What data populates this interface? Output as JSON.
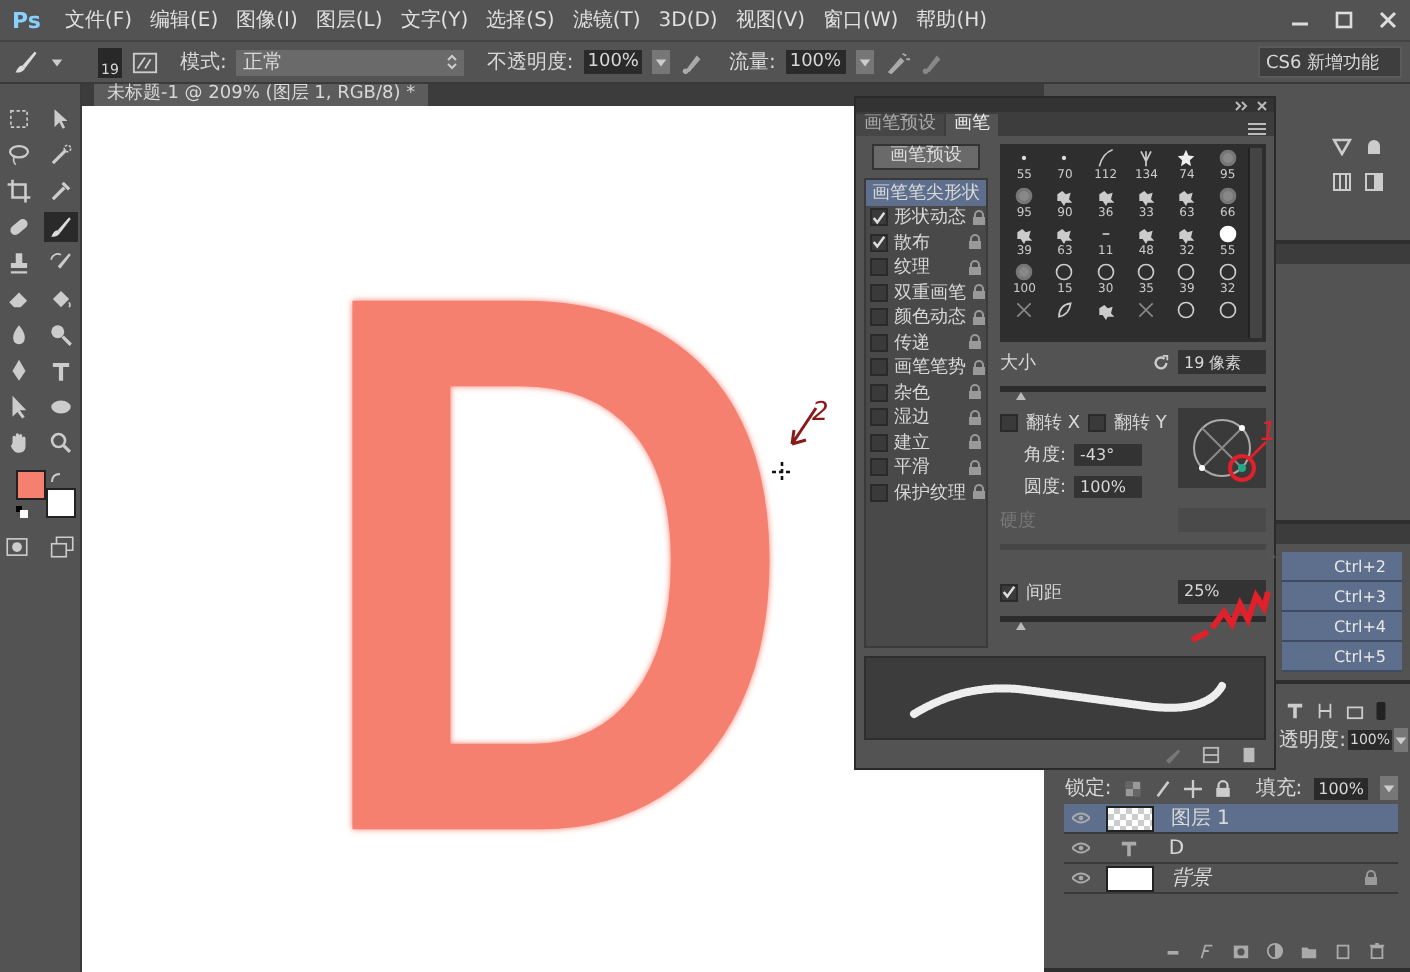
{
  "app": {
    "logo": "Ps"
  },
  "menu": [
    "文件(F)",
    "编辑(E)",
    "图像(I)",
    "图层(L)",
    "文字(Y)",
    "选择(S)",
    "滤镜(T)",
    "3D(D)",
    "视图(V)",
    "窗口(W)",
    "帮助(H)"
  ],
  "options": {
    "size": "19",
    "mode_label": "模式:",
    "mode": "正常",
    "opacity_label": "不透明度:",
    "opacity": "100%",
    "flow_label": "流量:",
    "flow": "100%",
    "workspace": "CS6 新增功能"
  },
  "document": {
    "tab": "未标题-1 @ 209% (图层 1, RGB/8) *",
    "letter": "D"
  },
  "tools": [
    {
      "kind": "marquee",
      "selected": false
    },
    {
      "kind": "move",
      "selected": false
    },
    {
      "kind": "lasso",
      "selected": false
    },
    {
      "kind": "quickselect",
      "selected": false
    },
    {
      "kind": "crop",
      "selected": false
    },
    {
      "kind": "eyedropper",
      "selected": false
    },
    {
      "kind": "healing",
      "selected": false
    },
    {
      "kind": "brush",
      "selected": true
    },
    {
      "kind": "stamp",
      "selected": false
    },
    {
      "kind": "historybrush",
      "selected": false
    },
    {
      "kind": "eraser",
      "selected": false
    },
    {
      "kind": "bucket",
      "selected": false
    },
    {
      "kind": "blur",
      "selected": false
    },
    {
      "kind": "dodge",
      "selected": false
    },
    {
      "kind": "pen",
      "selected": false
    },
    {
      "kind": "text",
      "selected": false
    },
    {
      "kind": "pathselect",
      "selected": false
    },
    {
      "kind": "ellipse",
      "selected": false
    },
    {
      "kind": "hand",
      "selected": false
    },
    {
      "kind": "zoom",
      "selected": false
    }
  ],
  "tools_bottom": [
    {
      "kind": "quickmask"
    },
    {
      "kind": "screenmode"
    }
  ],
  "brush_panel": {
    "tabs": [
      {
        "label": "画笔预设",
        "selected": false
      },
      {
        "label": "画笔",
        "selected": true
      }
    ],
    "preset_button": "画笔预设",
    "sections": [
      {
        "kind": "header",
        "label": "画笔笔尖形状",
        "selected": true
      },
      {
        "kind": "option",
        "label": "形状动态",
        "checked": true
      },
      {
        "kind": "option",
        "label": "散布",
        "checked": true
      },
      {
        "kind": "option",
        "label": "纹理",
        "checked": false
      },
      {
        "kind": "option",
        "label": "双重画笔",
        "checked": false
      },
      {
        "kind": "option",
        "label": "颜色动态",
        "checked": false
      },
      {
        "kind": "option",
        "label": "传递",
        "checked": false
      },
      {
        "kind": "option",
        "label": "画笔笔势",
        "checked": false
      },
      {
        "kind": "option",
        "label": "杂色",
        "checked": false
      },
      {
        "kind": "option",
        "label": "湿边",
        "checked": false
      },
      {
        "kind": "option",
        "label": "建立",
        "checked": false
      },
      {
        "kind": "option",
        "label": "平滑",
        "checked": false
      },
      {
        "kind": "option",
        "label": "保护纹理",
        "checked": false
      }
    ],
    "tips": [
      {
        "kind": "dot",
        "size": "55"
      },
      {
        "kind": "dot",
        "size": "70"
      },
      {
        "kind": "stroke",
        "size": "112"
      },
      {
        "kind": "grass",
        "size": "134"
      },
      {
        "kind": "star",
        "size": "74"
      },
      {
        "kind": "soft",
        "size": "95"
      },
      {
        "kind": "soft",
        "size": "95"
      },
      {
        "kind": "splat",
        "size": "90"
      },
      {
        "kind": "splat",
        "size": "36"
      },
      {
        "kind": "splat",
        "size": "33"
      },
      {
        "kind": "splat",
        "size": "63"
      },
      {
        "kind": "soft",
        "size": "66"
      },
      {
        "kind": "splat",
        "size": "39"
      },
      {
        "kind": "splat",
        "size": "63"
      },
      {
        "kind": "dash",
        "size": "11"
      },
      {
        "kind": "splat",
        "size": "48"
      },
      {
        "kind": "splat",
        "size": "32"
      },
      {
        "kind": "hard",
        "size": "55"
      },
      {
        "kind": "soft",
        "size": "100"
      },
      {
        "kind": "ring",
        "size": "15"
      },
      {
        "kind": "ring",
        "size": "30"
      },
      {
        "kind": "ring",
        "size": "35"
      },
      {
        "kind": "ring",
        "size": "39"
      },
      {
        "kind": "ring",
        "size": "32"
      },
      {
        "kind": "cross"
      },
      {
        "kind": "leaf"
      },
      {
        "kind": "splat"
      },
      {
        "kind": "cross"
      },
      {
        "kind": "ring"
      },
      {
        "kind": "ring"
      }
    ],
    "size_label": "大小",
    "size": "19 像素",
    "size_slider": {
      "level": 0.06
    },
    "flips": [
      {
        "label": "翻转 X",
        "checked": false
      },
      {
        "label": "翻转 Y",
        "checked": false
      }
    ],
    "angle_label": "角度:",
    "angle": "-43°",
    "roundness_label": "圆度:",
    "roundness": "100%",
    "hardness": {
      "label": "硬度",
      "disabled": true,
      "level": 1
    },
    "spacing": {
      "label": "间距",
      "checked": true,
      "value": "25%",
      "level": 0.06
    }
  },
  "channels": [
    {
      "shortcut": "Ctrl+2"
    },
    {
      "shortcut": "Ctrl+3"
    },
    {
      "shortcut": "Ctrl+4"
    },
    {
      "shortcut": "Ctrl+5"
    }
  ],
  "layers": {
    "opacity_label": "透明度:",
    "opacity": "100%",
    "lock_label": "锁定:",
    "fill_label": "填充:",
    "fill": "100%",
    "items": [
      {
        "kind": "pixel",
        "name": "图层 1",
        "selected": true
      },
      {
        "kind": "text",
        "name": "D",
        "selected": false
      },
      {
        "kind": "background",
        "name": "背景",
        "selected": false
      }
    ]
  },
  "annotations": [
    {
      "label": "2"
    },
    {
      "label": "1"
    }
  ]
}
